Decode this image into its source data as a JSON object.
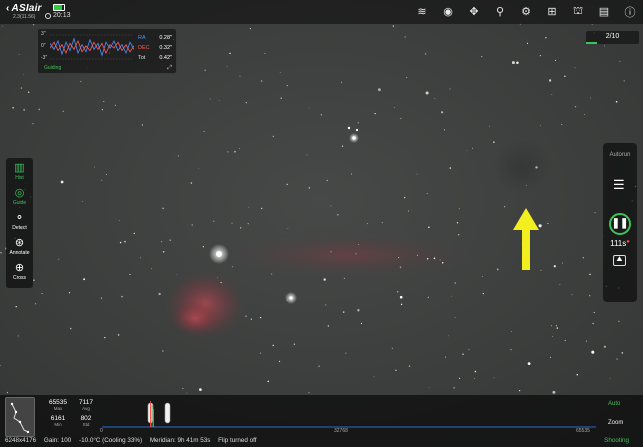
{
  "app": {
    "name": "ASIair",
    "version": "2.3(11.56)",
    "time": "20:13",
    "battery_level": 0.8
  },
  "top_icons": [
    {
      "name": "wifi-icon",
      "glyph": "≋"
    },
    {
      "name": "camera-icon",
      "glyph": "◉"
    },
    {
      "name": "guide-scope-icon",
      "glyph": "✥"
    },
    {
      "name": "telescope-icon",
      "glyph": "⚲"
    },
    {
      "name": "focuser-icon",
      "glyph": "⚙"
    },
    {
      "name": "filter-wheel-icon",
      "glyph": "⊞"
    },
    {
      "name": "observatory-icon",
      "glyph": "⛫"
    },
    {
      "name": "storage-icon",
      "glyph": "▤"
    },
    {
      "name": "info-icon",
      "glyph": "ⓘ"
    }
  ],
  "guide": {
    "y_labels": [
      "3\"",
      "0\"",
      "-3\""
    ],
    "stats": [
      {
        "key": "RA",
        "value": "0.28\""
      },
      {
        "key": "DEC",
        "value": "0.32\""
      },
      {
        "key": "Tot",
        "value": "0.42\""
      }
    ],
    "status": "Guiding",
    "ra_points": [
      0.3,
      -0.2,
      0.5,
      -0.6,
      0.4,
      -0.3,
      0.7,
      -0.5,
      0.2,
      -0.4,
      0.6,
      -0.2,
      0.3,
      -0.7,
      0.4,
      -0.1,
      0.5,
      -0.3,
      0.2,
      -0.5,
      0.4,
      -0.2
    ],
    "dec_points": [
      -0.1,
      0.4,
      -0.3,
      0.2,
      -0.5,
      0.3,
      -0.2,
      0.5,
      -0.4,
      0.1,
      -0.3,
      0.4,
      -0.2,
      0.3,
      -0.5,
      0.2,
      -0.1,
      0.4,
      -0.3,
      0.2,
      -0.4,
      0.1
    ],
    "colors": {
      "ra": "#4e8fff",
      "dec": "#ff5a5a"
    }
  },
  "sequence": {
    "count": "2/10",
    "progress": 0.2
  },
  "left_tools": [
    {
      "label": "Hist",
      "glyph": "▥",
      "name": "hist-icon",
      "active": true
    },
    {
      "label": "Guide",
      "glyph": "◎",
      "name": "guide-icon",
      "active": true
    },
    {
      "label": "Detect",
      "glyph": "⚬",
      "name": "detect-icon",
      "active": false
    },
    {
      "label": "Annotate",
      "glyph": "⊛",
      "name": "annotate-icon",
      "active": false
    },
    {
      "label": "Cross",
      "glyph": "⊕",
      "name": "cross-icon",
      "active": false
    }
  ],
  "right": {
    "autorun": "Autorun",
    "exposure": "111s"
  },
  "histogram": {
    "max": "65535",
    "max_label": "Max",
    "avg": "7117",
    "avg_label": "Avg",
    "min": "6161",
    "min_label": "Min",
    "std": "802",
    "std_label": "Std",
    "axis_start": "0",
    "axis_mid": "32768",
    "axis_end": "65535",
    "auto": "Auto",
    "zoom": "Zoom"
  },
  "status": {
    "resolution": "6248x4176",
    "gain": "Gain: 100",
    "temp": "-10.0°C (Cooling 33%)",
    "meridian": "Meridian: 9h 41m 53s",
    "flip": "Flip turned off",
    "state": "Shooting"
  },
  "colors": {
    "accent": "#3fc15b",
    "arrow": "#f2ee1f",
    "nebula": "#b3414a"
  }
}
